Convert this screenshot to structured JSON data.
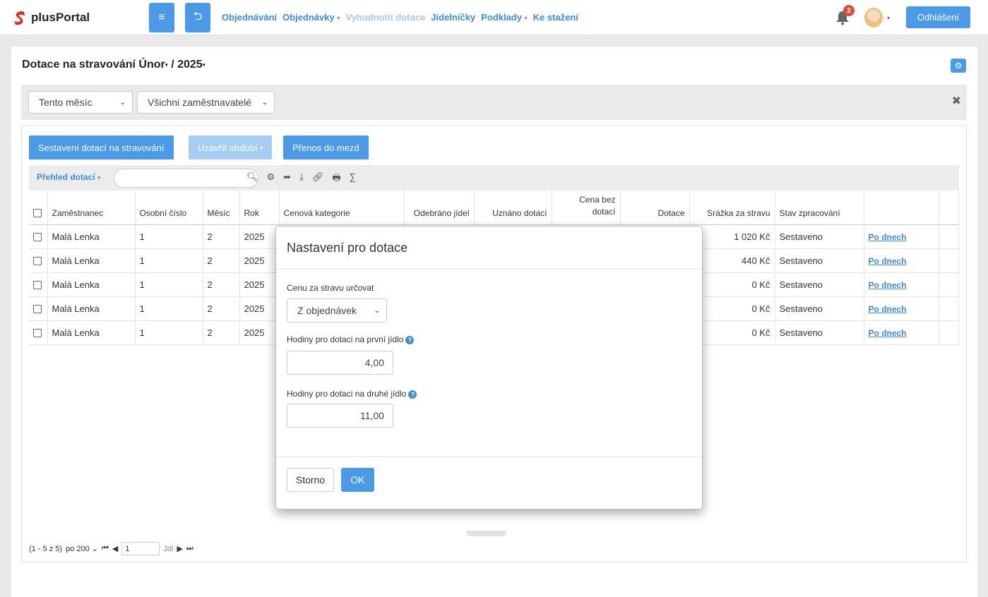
{
  "brand": {
    "name": "plusPortal"
  },
  "navbar": {
    "links": [
      {
        "label": "Objednávání",
        "caret": "",
        "disabled": false
      },
      {
        "label": "Objednávky",
        "caret": "▾",
        "disabled": false
      },
      {
        "label": "Vyhodnotit dotace",
        "caret": "",
        "disabled": true
      },
      {
        "label": "Jídelníčky",
        "caret": "",
        "disabled": false
      },
      {
        "label": "Podklady",
        "caret": "▾",
        "disabled": false
      },
      {
        "label": "Ke stažení",
        "caret": "",
        "disabled": false
      }
    ],
    "notification_count": "2",
    "logout_label": "Odhlášení",
    "menu_icon": "hamburger-menu-icon",
    "back_icon": "back-arrow-icon"
  },
  "page": {
    "title_prefix": "Dotace na stravování",
    "month": "Únor",
    "year_sep": "/ 2025"
  },
  "filters": {
    "period": "Tento měsíc",
    "employer": "Všichni zaměstnavatelé"
  },
  "toolbar": {
    "build_label": "Sestavení dotací na stravování",
    "close_period_label": "Uzavřít období",
    "transfer_label": "Přenos do mezd",
    "view_label": "Přehled dotací"
  },
  "table": {
    "headers": [
      "Zaměstnanec",
      "Osobní číslo",
      "Měsíc",
      "Rok",
      "Cenová kategorie",
      "Odebráno jídel",
      "Uznáno dotací",
      "Cena bez dotací",
      "Dotace",
      "Srážka za stravu",
      "Stav zpracování"
    ],
    "rows": [
      {
        "employee": "Malá Lenka",
        "personal_no": "1",
        "month": "2",
        "year": "2025",
        "deduction": "1 020 Kč",
        "status": "Sestaveno",
        "link": "Po dnech"
      },
      {
        "employee": "Malá Lenka",
        "personal_no": "1",
        "month": "2",
        "year": "2025",
        "deduction": "440 Kč",
        "status": "Sestaveno",
        "link": "Po dnech"
      },
      {
        "employee": "Malá Lenka",
        "personal_no": "1",
        "month": "2",
        "year": "2025",
        "deduction": "0 Kč",
        "status": "Sestaveno",
        "link": "Po dnech"
      },
      {
        "employee": "Malá Lenka",
        "personal_no": "1",
        "month": "2",
        "year": "2025",
        "deduction": "0 Kč",
        "status": "Sestaveno",
        "link": "Po dnech"
      },
      {
        "employee": "Malá Lenka",
        "personal_no": "1",
        "month": "2",
        "year": "2025",
        "deduction": "0 Kč",
        "status": "Sestaveno",
        "link": "Po dnech"
      }
    ]
  },
  "pager": {
    "summary": "(1 - 5 z 5)",
    "page_size": "po 200",
    "page_value": "1",
    "go_label": "Jdi"
  },
  "modal": {
    "title": "Nastavení pro dotace",
    "price_label": "Cenu za stravu určovat",
    "price_source": "Z objednávek",
    "first_meal_label": "Hodiny pro dotaci na první jídlo",
    "first_meal_value": "4,00",
    "second_meal_label": "Hodiny pro dotaci na druhé jídlo",
    "second_meal_value": "11,00",
    "cancel_label": "Storno",
    "ok_label": "OK"
  },
  "colors": {
    "accent": "#4a9ae8",
    "link": "#3d8bd8",
    "badge": "#e24b3c"
  }
}
